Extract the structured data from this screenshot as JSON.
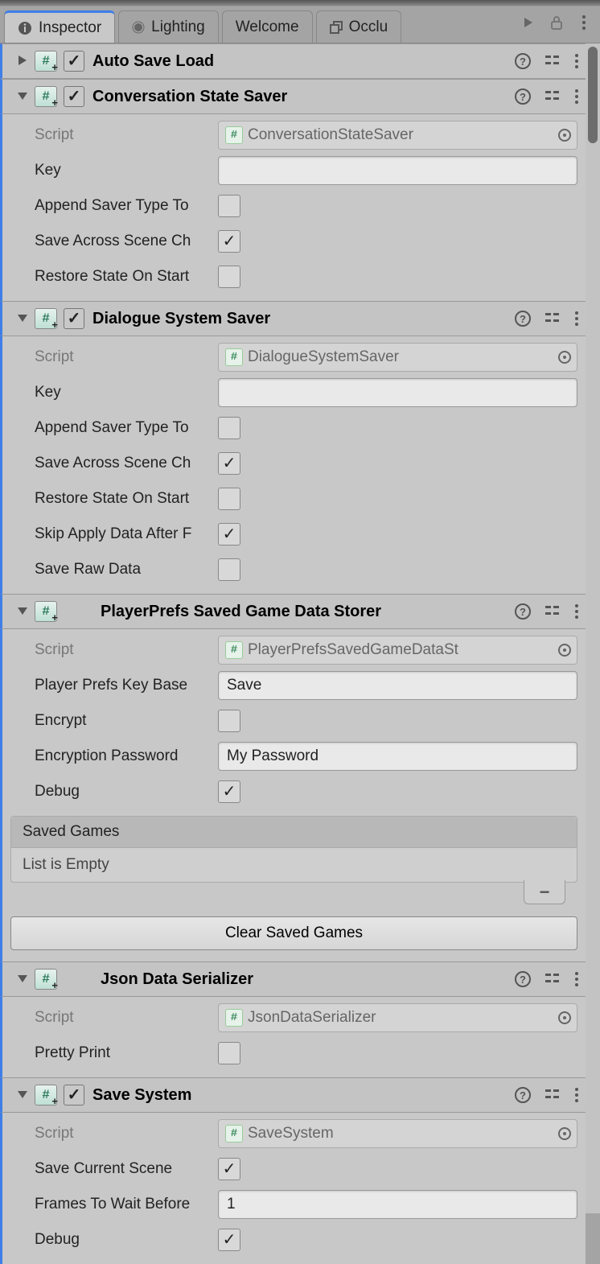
{
  "tabs": {
    "inspector": "Inspector",
    "lighting": "Lighting",
    "welcome": "Welcome",
    "occlusion": "Occlu"
  },
  "comp_auto_save": {
    "title": "Auto Save Load"
  },
  "comp_conv_saver": {
    "title": "Conversation State Saver",
    "script_label": "Script",
    "script_value": "ConversationStateSaver",
    "key_label": "Key",
    "key_value": "",
    "append_label": "Append Saver Type To",
    "save_across_label": "Save Across Scene Ch",
    "restore_label": "Restore State On Start"
  },
  "comp_dialogue_saver": {
    "title": "Dialogue System Saver",
    "script_label": "Script",
    "script_value": "DialogueSystemSaver",
    "key_label": "Key",
    "key_value": "",
    "append_label": "Append Saver Type To",
    "save_across_label": "Save Across Scene Ch",
    "restore_label": "Restore State On Start",
    "skip_apply_label": "Skip Apply Data After F",
    "save_raw_label": "Save Raw Data"
  },
  "comp_playerprefs": {
    "title": "PlayerPrefs Saved Game Data Storer",
    "script_label": "Script",
    "script_value": "PlayerPrefsSavedGameDataSt",
    "keybase_label": "Player Prefs Key Base",
    "keybase_value": "Save",
    "encrypt_label": "Encrypt",
    "enc_pass_label": "Encryption Password",
    "enc_pass_value": "My Password",
    "debug_label": "Debug",
    "list_header": "Saved Games",
    "list_empty": "List is Empty",
    "clear_button": "Clear Saved Games"
  },
  "comp_json": {
    "title": "Json Data Serializer",
    "script_label": "Script",
    "script_value": "JsonDataSerializer",
    "pretty_label": "Pretty Print"
  },
  "comp_save_system": {
    "title": "Save System",
    "script_label": "Script",
    "script_value": "SaveSystem",
    "save_scene_label": "Save Current Scene",
    "frames_label": "Frames To Wait Before",
    "frames_value": "1",
    "debug_label": "Debug"
  }
}
